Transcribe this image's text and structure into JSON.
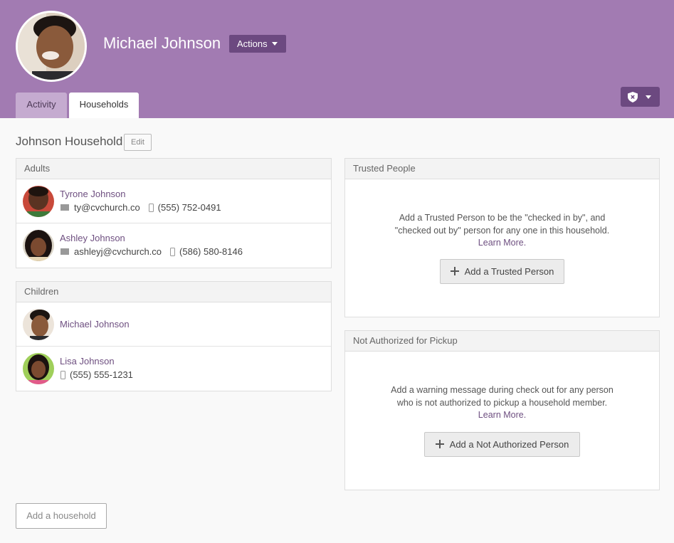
{
  "person": {
    "name": "Michael Johnson",
    "actions_label": "Actions"
  },
  "tabs": [
    {
      "label": "Activity"
    },
    {
      "label": "Households"
    }
  ],
  "household": {
    "title": "Johnson Household",
    "edit_label": "Edit",
    "adults_header": "Adults",
    "adults": [
      {
        "name": "Tyrone Johnson",
        "email": "ty@cvchurch.co",
        "phone": "(555) 752-0491"
      },
      {
        "name": "Ashley Johnson",
        "email": "ashleyj@cvchurch.co",
        "phone": "(586) 580-8146"
      }
    ],
    "children_header": "Children",
    "children": [
      {
        "name": "Michael Johnson"
      },
      {
        "name": "Lisa Johnson",
        "phone": "(555) 555-1231"
      }
    ]
  },
  "trusted": {
    "header": "Trusted People",
    "line1": "Add a Trusted Person to be the \"checked in by\", and",
    "line2": "\"checked out by\" person for any one in this household.",
    "learn_more": "Learn More.",
    "button": "Add a Trusted Person"
  },
  "not_authorized": {
    "header": "Not Authorized for Pickup",
    "line1": "Add a warning message during check out for any person",
    "line2": "who is not authorized to pickup a household member.",
    "learn_more": "Learn More.",
    "button": "Add a Not Authorized Person"
  },
  "add_household_label": "Add a household",
  "icons": {
    "settings": "shield-x-icon",
    "email": "mail-icon",
    "phone": "phone-icon",
    "add": "plus-icon"
  },
  "colors": {
    "header_bg": "#a27bb2",
    "accent_dark": "#6c4980",
    "link": "#6e4f80"
  }
}
